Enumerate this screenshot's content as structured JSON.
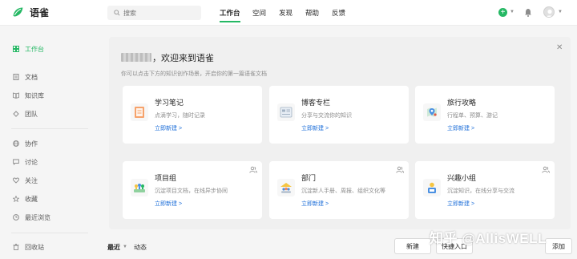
{
  "app": {
    "name": "语雀",
    "brand_color": "#25b864"
  },
  "search": {
    "placeholder": "搜索"
  },
  "nav": [
    {
      "label": "工作台",
      "active": true
    },
    {
      "label": "空间"
    },
    {
      "label": "发现"
    },
    {
      "label": "帮助"
    },
    {
      "label": "反馈"
    }
  ],
  "sidebar": {
    "items": [
      {
        "label": "工作台",
        "icon": "dashboard-icon",
        "active": true
      },
      {
        "label": "文档",
        "icon": "document-icon"
      },
      {
        "label": "知识库",
        "icon": "book-icon"
      },
      {
        "label": "团队",
        "icon": "team-icon"
      },
      {
        "label": "协作",
        "icon": "globe-icon"
      },
      {
        "label": "讨论",
        "icon": "chat-icon"
      },
      {
        "label": "关注",
        "icon": "heart-icon"
      },
      {
        "label": "收藏",
        "icon": "star-icon"
      },
      {
        "label": "最近浏览",
        "icon": "clock-icon"
      },
      {
        "label": "回收站",
        "icon": "trash-icon"
      }
    ]
  },
  "welcome": {
    "title": "，欢迎来到语雀",
    "subtitle": "你可以点击下方的知识创作场景，开启你的第一篇语雀文档"
  },
  "cards": [
    {
      "title": "学习笔记",
      "desc": "点滴学习，随时记录",
      "link": "立即新建 >",
      "icon": "notebook-icon"
    },
    {
      "title": "博客专栏",
      "desc": "分享与交流你的知识",
      "link": "立即新建 >",
      "icon": "blog-icon"
    },
    {
      "title": "旅行攻略",
      "desc": "行程单、预算、游记",
      "link": "立即新建 >",
      "icon": "map-pin-icon"
    },
    {
      "title": "项目组",
      "desc": "沉淀项目文档，在线异步协同",
      "link": "立即新建 >",
      "icon": "project-icon",
      "team": true
    },
    {
      "title": "部门",
      "desc": "沉淀新人手册、周报、组织文化等",
      "link": "立即新建 >",
      "icon": "department-icon",
      "team": true
    },
    {
      "title": "兴趣小组",
      "desc": "沉淀知识，在线分享与交流",
      "link": "立即新建 >",
      "icon": "interest-group-icon",
      "team": true
    }
  ],
  "bottom": {
    "tabs": [
      {
        "label": "最近",
        "bold": true
      },
      {
        "label": "动态"
      }
    ],
    "buttons": [
      {
        "label": "新建"
      },
      {
        "label": "快捷入口"
      },
      {
        "label": "添加"
      }
    ]
  },
  "watermark": "知乎 @AllisWELL"
}
